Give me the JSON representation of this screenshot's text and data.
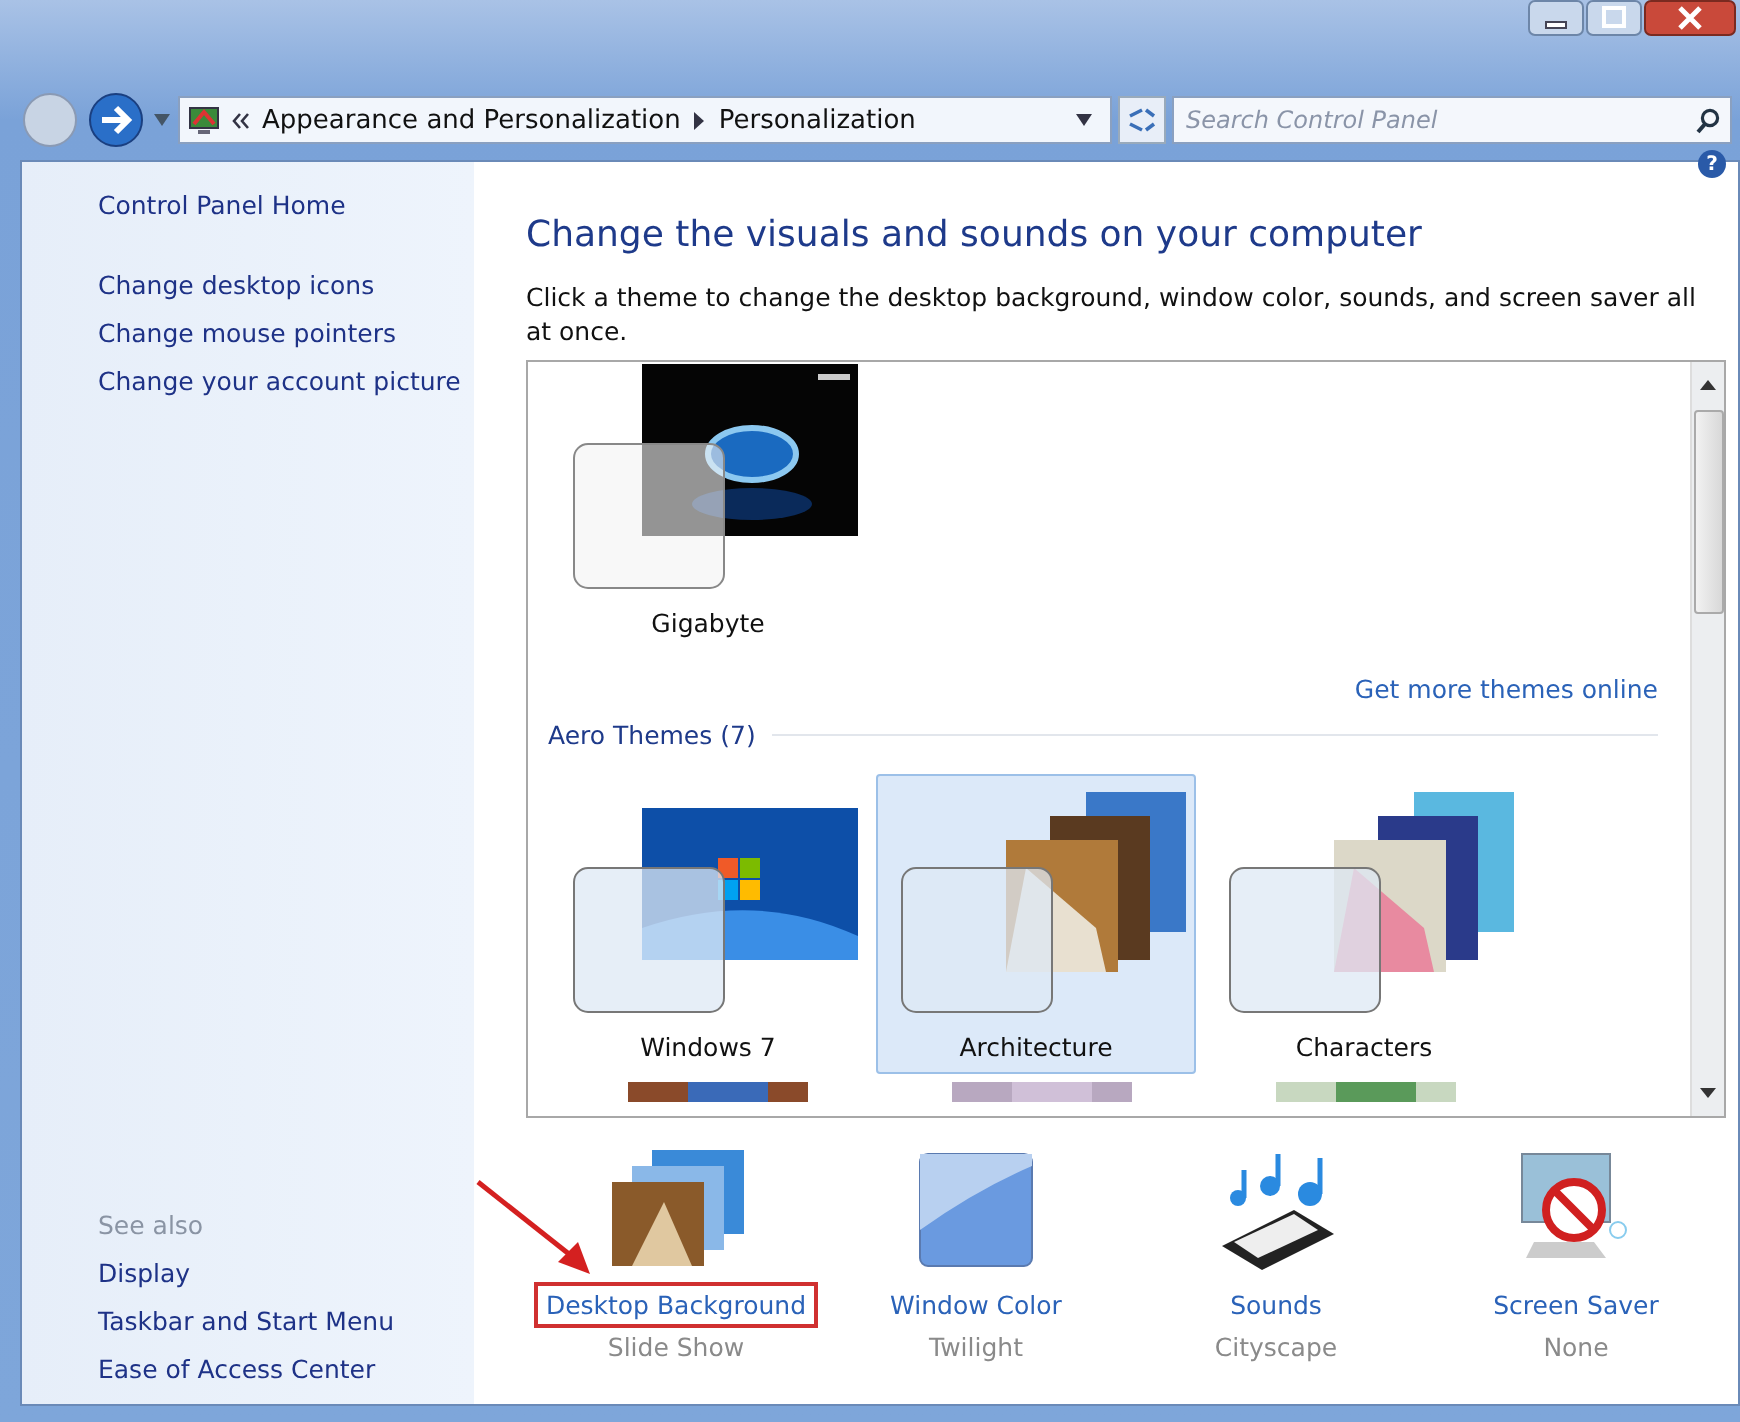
{
  "address_bar": {
    "breadcrumbs": [
      "Appearance and Personalization",
      "Personalization"
    ],
    "search": {
      "placeholder": "Search Control Panel"
    }
  },
  "help_button": "?",
  "sidebar": {
    "items": [
      "Control Panel Home",
      "Change desktop icons",
      "Change mouse pointers",
      "Change your account picture"
    ],
    "see_also": {
      "title": "See also",
      "items": [
        "Display",
        "Taskbar and Start Menu",
        "Ease of Access Center"
      ]
    }
  },
  "main": {
    "heading": "Change the visuals and sounds on your computer",
    "description": "Click a theme to change the desktop background, window color, sounds, and screen saver all at once.",
    "my_themes": [
      {
        "name": "Gigabyte",
        "selected": false
      }
    ],
    "more_themes_link": "Get more themes online",
    "group_title": "Aero Themes (7)",
    "aero_themes": [
      {
        "name": "Windows 7",
        "selected": false
      },
      {
        "name": "Architecture",
        "selected": true
      },
      {
        "name": "Characters",
        "selected": false
      }
    ],
    "settings": [
      {
        "kind": "background",
        "label": "Desktop Background",
        "value": "Slide Show",
        "highlighted": true
      },
      {
        "kind": "color",
        "label": "Window Color",
        "value": "Twilight",
        "highlighted": false
      },
      {
        "kind": "sounds",
        "label": "Sounds",
        "value": "Cityscape",
        "highlighted": false
      },
      {
        "kind": "saver",
        "label": "Screen Saver",
        "value": "None",
        "highlighted": false
      }
    ]
  }
}
